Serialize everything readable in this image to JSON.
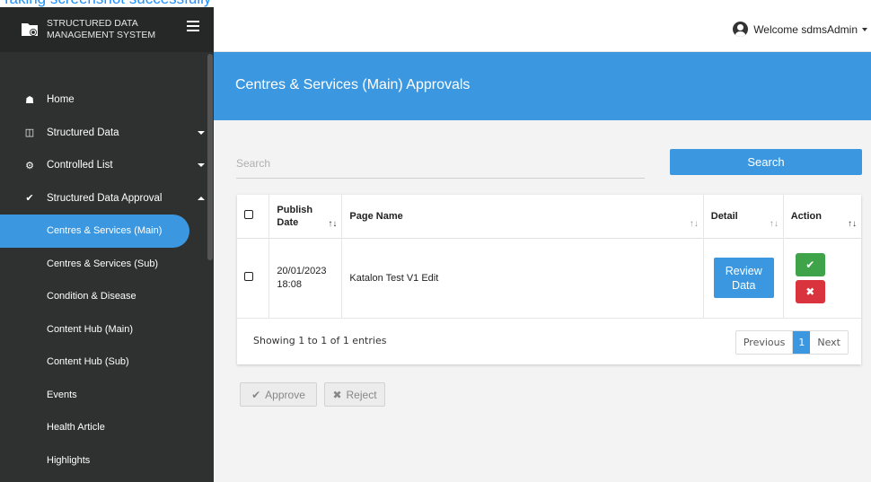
{
  "banner": {
    "text": "Taking screenshot successfully"
  },
  "brand": {
    "title": "STRUCTURED DATA MANAGEMENT SYSTEM"
  },
  "topbar": {
    "welcome": "Welcome sdmsAdmin"
  },
  "nav": {
    "items": [
      {
        "label": "Home",
        "icon": "home-icon"
      },
      {
        "label": "Structured Data",
        "icon": "database-icon"
      },
      {
        "label": "Controlled List",
        "icon": "cogs-icon"
      },
      {
        "label": "Structured Data Approval",
        "icon": "check-icon"
      }
    ],
    "sub_items": [
      "Centres & Services (Main)",
      "Centres & Services (Sub)",
      "Condition & Disease",
      "Content Hub (Main)",
      "Content Hub (Sub)",
      "Events",
      "Health Article",
      "Highlights"
    ]
  },
  "page": {
    "title": "Centres & Services (Main) Approvals"
  },
  "search": {
    "placeholder": "Search",
    "button": "Search"
  },
  "table": {
    "headers": {
      "publish_date": "Publish Date",
      "page_name": "Page Name",
      "detail": "Detail",
      "action": "Action"
    },
    "rows": [
      {
        "publish_date": "20/01/2023 18:08",
        "page_name": "Katalon Test V1 Edit",
        "detail_button": "Review Data"
      }
    ],
    "showing": "Showing 1 to 1 of 1 entries",
    "pagination": {
      "previous": "Previous",
      "current": "1",
      "next": "Next"
    }
  },
  "actions": {
    "approve": "Approve",
    "reject": "Reject"
  },
  "colors": {
    "primary": "#3b98e0",
    "sidebar": "#2f3030",
    "approve": "#3fa34a",
    "reject": "#d9343d"
  }
}
